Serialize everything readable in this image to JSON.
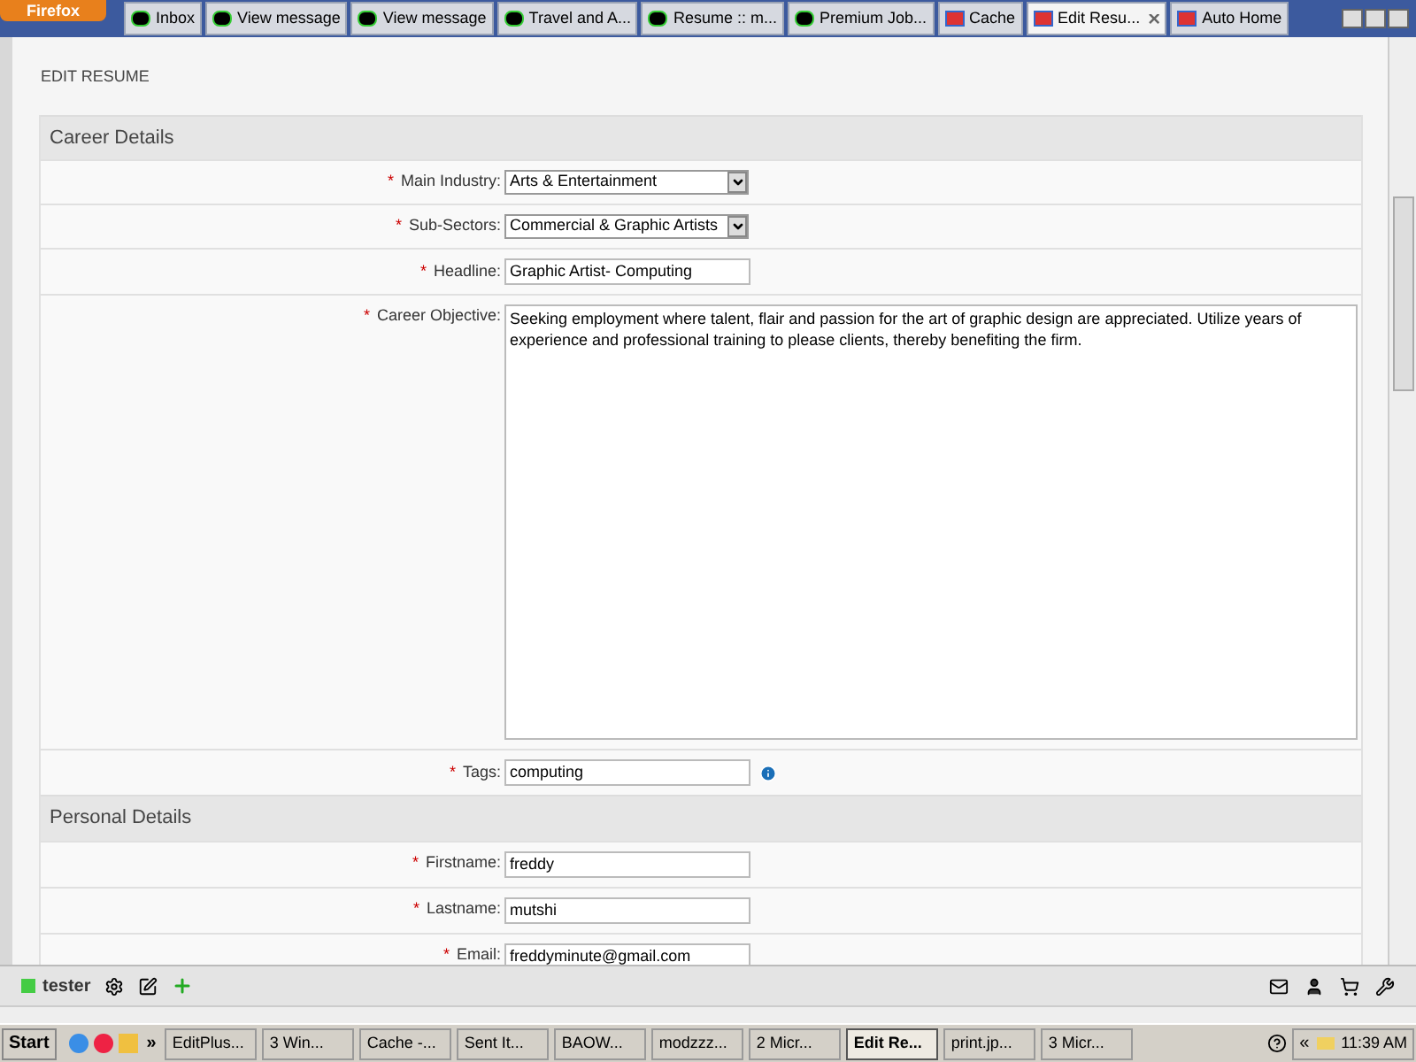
{
  "browser": {
    "menu_button": "Firefox",
    "tabs": [
      {
        "label": "Inbox",
        "selected": false,
        "kind": "mail"
      },
      {
        "label": "View message",
        "selected": false,
        "kind": "mail"
      },
      {
        "label": "View message",
        "selected": false,
        "kind": "mail"
      },
      {
        "label": "Travel and A...",
        "selected": false,
        "kind": "mail"
      },
      {
        "label": "Resume :: m...",
        "selected": false,
        "kind": "mail"
      },
      {
        "label": "Premium Job...",
        "selected": false,
        "kind": "mail"
      },
      {
        "label": "Cache",
        "selected": false,
        "kind": "site"
      },
      {
        "label": "Edit Resu...",
        "selected": true,
        "kind": "site"
      },
      {
        "label": "Auto Home",
        "selected": false,
        "kind": "site"
      }
    ]
  },
  "page": {
    "title": "EDIT RESUME",
    "sections": [
      {
        "title": "Career Details",
        "fields": [
          {
            "kind": "select",
            "mark": "*",
            "label": "Main Industry:",
            "value": "Arts & Entertainment"
          },
          {
            "kind": "select",
            "mark": "*",
            "label": "Sub-Sectors:",
            "value": "Commercial & Graphic Artists"
          },
          {
            "kind": "text",
            "mark": "*",
            "label": "Headline:",
            "value": "Graphic Artist- Computing"
          },
          {
            "kind": "textarea",
            "mark": "*",
            "label": "Career Objective:",
            "value": "Seeking employment where talent, flair and passion for the art of graphic design are appreciated. Utilize years of experience and professional training to please clients, thereby benefiting the firm."
          },
          {
            "kind": "text",
            "mark": "*",
            "label": "Tags:",
            "value": "computing",
            "info": true
          }
        ]
      },
      {
        "title": "Personal Details",
        "fields": [
          {
            "kind": "text",
            "mark": "*",
            "label": "Firstname:",
            "value": "freddy"
          },
          {
            "kind": "text",
            "mark": "*",
            "label": "Lastname:",
            "value": "mutshi"
          },
          {
            "kind": "text",
            "mark": "*",
            "label": "Email:",
            "value": "freddyminute@gmail.com"
          }
        ]
      }
    ]
  },
  "addon_bar": {
    "user": "tester"
  },
  "taskbar": {
    "start": "Start",
    "more": "»",
    "items": [
      {
        "label": "EditPlus...",
        "selected": false
      },
      {
        "label": "3 Win...",
        "selected": false
      },
      {
        "label": "Cache -...",
        "selected": false
      },
      {
        "label": "Sent It...",
        "selected": false
      },
      {
        "label": "BAOW...",
        "selected": false
      },
      {
        "label": "modzzz...",
        "selected": false
      },
      {
        "label": "2 Micr...",
        "selected": false
      },
      {
        "label": "Edit Re...",
        "selected": true
      },
      {
        "label": "print.jp...",
        "selected": false
      },
      {
        "label": "3 Micr...",
        "selected": false
      }
    ],
    "tray_toggle": "«",
    "clock": "11:39 AM"
  }
}
